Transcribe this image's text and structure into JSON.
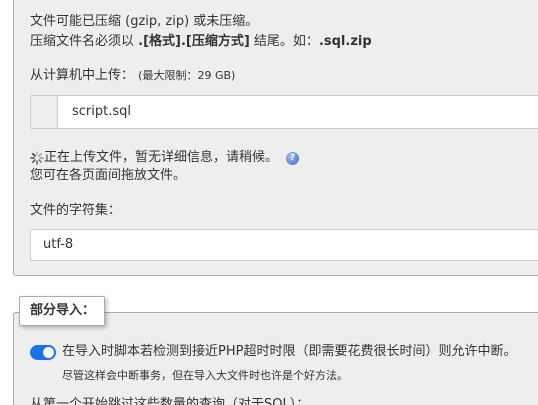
{
  "upload_section": {
    "compression_note_line1": "文件可能已压缩 (gzip, zip) 或未压缩。",
    "compression_note_line2_prefix": "压缩文件名必须以 ",
    "compression_note_line2_format": ".[格式].[压缩方式]",
    "compression_note_line2_middle": " 结尾。如：",
    "compression_note_line2_example": ".sql.zip",
    "upload_label": "从计算机中上传：",
    "upload_limit": "(最大限制：29 GB)",
    "file_name": "script.sql",
    "uploading_status": "正在上传文件，暂无详细信息，请稍候。",
    "help_icon_glyph": "?",
    "drag_hint": "您可在各页面间拖放文件。",
    "charset_label": "文件的字符集：",
    "charset_value": "utf-8"
  },
  "partial_import": {
    "legend": "部分导入：",
    "interrupt_toggle_label": "在导入时脚本若检测到接近PHP超时时限（即需要花费很长时间）则允许中断。",
    "interrupt_toggle_on": true,
    "interrupt_note": "尽管这样会中断事务，但在导入大文件时也许是个好方法。",
    "skip_queries_label": "从第一个开始跳过这些数量的查询（对于SQL）："
  },
  "colors": {
    "toggle_accent": "#1a73e8",
    "help_icon": "#3a67c0",
    "panel_bg": "#eeeeee"
  }
}
